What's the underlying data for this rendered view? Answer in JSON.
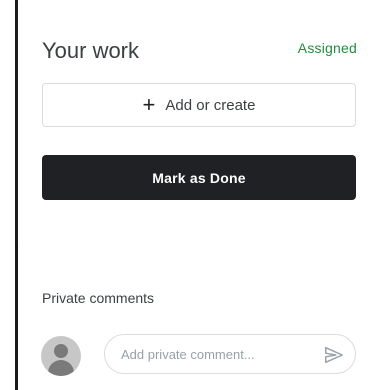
{
  "work": {
    "title": "Your work",
    "status": "Assigned",
    "add_label": "Add or create",
    "done_label": "Mark as Done"
  },
  "comments": {
    "section_label": "Private comments",
    "input_placeholder": "Add private comment..."
  },
  "colors": {
    "status_green": "#1e8e3e",
    "done_button": "#202124"
  },
  "icons": {
    "add": "plus-icon",
    "send": "send-icon",
    "avatar": "avatar-icon"
  }
}
